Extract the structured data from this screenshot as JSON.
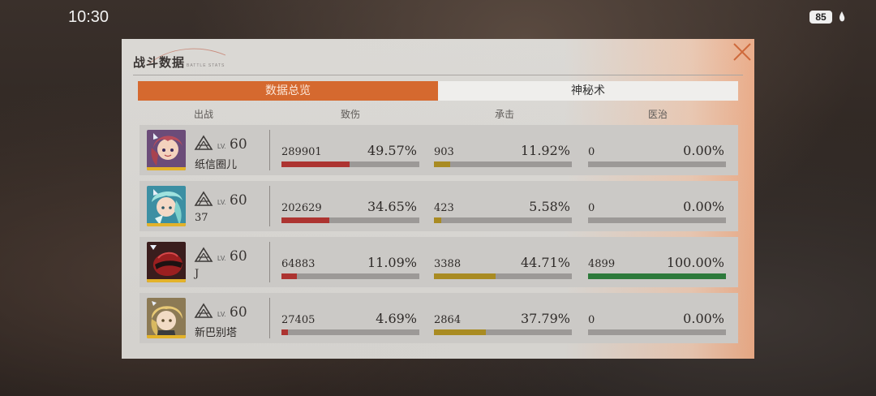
{
  "status_bar": {
    "time": "10:30",
    "battery": "85"
  },
  "panel": {
    "title": "战斗数据",
    "subtitle": "BATTLE STATS",
    "tabs": [
      {
        "label": "数据总览",
        "active": true
      },
      {
        "label": "神秘术",
        "active": false
      }
    ],
    "columns": [
      "出战",
      "致伤",
      "承击",
      "医治"
    ],
    "level_prefix": "LV.",
    "rows": [
      {
        "name": "纸信圈儿",
        "level": "60",
        "portrait": "pink-hair-girl",
        "damage": {
          "value": "289901",
          "pct": "49.57%",
          "fraction": 0.4957
        },
        "taken": {
          "value": "903",
          "pct": "11.92%",
          "fraction": 0.1192
        },
        "heal": {
          "value": "0",
          "pct": "0.00%",
          "fraction": 0
        }
      },
      {
        "name": "37",
        "level": "60",
        "portrait": "teal-hair-girl",
        "damage": {
          "value": "202629",
          "pct": "34.65%",
          "fraction": 0.3465
        },
        "taken": {
          "value": "423",
          "pct": "5.58%",
          "fraction": 0.0558
        },
        "heal": {
          "value": "0",
          "pct": "0.00%",
          "fraction": 0
        }
      },
      {
        "name": "J",
        "level": "60",
        "portrait": "red-helmet",
        "damage": {
          "value": "64883",
          "pct": "11.09%",
          "fraction": 0.1109
        },
        "taken": {
          "value": "3388",
          "pct": "44.71%",
          "fraction": 0.4471
        },
        "heal": {
          "value": "4899",
          "pct": "100.00%",
          "fraction": 1.0
        }
      },
      {
        "name": "新巴别塔",
        "level": "60",
        "portrait": "blonde-girl",
        "damage": {
          "value": "27405",
          "pct": "4.69%",
          "fraction": 0.0469
        },
        "taken": {
          "value": "2864",
          "pct": "37.79%",
          "fraction": 0.3779
        },
        "heal": {
          "value": "0",
          "pct": "0.00%",
          "fraction": 0
        }
      }
    ]
  },
  "colors": {
    "accent": "#d5692f",
    "damage_bar": "#ad3431",
    "taken_bar": "#a98b22",
    "heal_bar": "#2d7a3b"
  }
}
